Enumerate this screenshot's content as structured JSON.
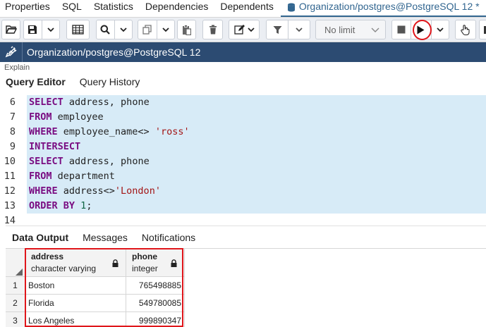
{
  "top_tabs": [
    "Properties",
    "SQL",
    "Statistics",
    "Dependencies",
    "Dependents"
  ],
  "active_tab": "Organization/postgres@PostgreSQL 12 *",
  "toolbar": {
    "limit_value": "No limit"
  },
  "connection": {
    "label": "Organization/postgres@PostgreSQL 12"
  },
  "strip_text": "Explain",
  "editor_tabs": [
    "Query Editor",
    "Query History"
  ],
  "code_lines": [
    {
      "num": "6",
      "tokens": [
        {
          "t": "SELECT",
          "c": "kw"
        },
        {
          "t": " address, phone",
          "c": ""
        }
      ]
    },
    {
      "num": "7",
      "tokens": [
        {
          "t": "FROM",
          "c": "kw"
        },
        {
          "t": " employee",
          "c": ""
        }
      ]
    },
    {
      "num": "8",
      "tokens": [
        {
          "t": "WHERE",
          "c": "kw"
        },
        {
          "t": " employee_name<> ",
          "c": ""
        },
        {
          "t": "'ross'",
          "c": "str"
        }
      ]
    },
    {
      "num": "9",
      "tokens": [
        {
          "t": "INTERSECT",
          "c": "kw"
        }
      ]
    },
    {
      "num": "10",
      "tokens": [
        {
          "t": "SELECT",
          "c": "kw"
        },
        {
          "t": " address, phone",
          "c": ""
        }
      ]
    },
    {
      "num": "11",
      "tokens": [
        {
          "t": "FROM",
          "c": "kw"
        },
        {
          "t": " department",
          "c": ""
        }
      ]
    },
    {
      "num": "12",
      "tokens": [
        {
          "t": "WHERE",
          "c": "kw"
        },
        {
          "t": " address<>",
          "c": ""
        },
        {
          "t": "'London'",
          "c": "str"
        }
      ]
    },
    {
      "num": "13",
      "tokens": [
        {
          "t": "ORDER BY",
          "c": "kw"
        },
        {
          "t": " ",
          "c": ""
        },
        {
          "t": "1",
          "c": "num"
        },
        {
          "t": ";",
          "c": ""
        }
      ]
    },
    {
      "num": "14",
      "tokens": []
    }
  ],
  "results_tabs": [
    "Data Output",
    "Messages",
    "Notifications"
  ],
  "columns": [
    {
      "name": "address",
      "type": "character varying"
    },
    {
      "name": "phone",
      "type": "integer"
    }
  ],
  "rows": [
    {
      "n": "1",
      "address": "Boston",
      "phone": "765498885"
    },
    {
      "n": "2",
      "address": "Florida",
      "phone": "549780085"
    },
    {
      "n": "3",
      "address": "Los Angeles",
      "phone": "999890347"
    }
  ],
  "colors": {
    "brand": "#326690",
    "conn_bar": "#2c4b72",
    "highlight": "#e0161b",
    "selection": "#d7ebf7"
  }
}
